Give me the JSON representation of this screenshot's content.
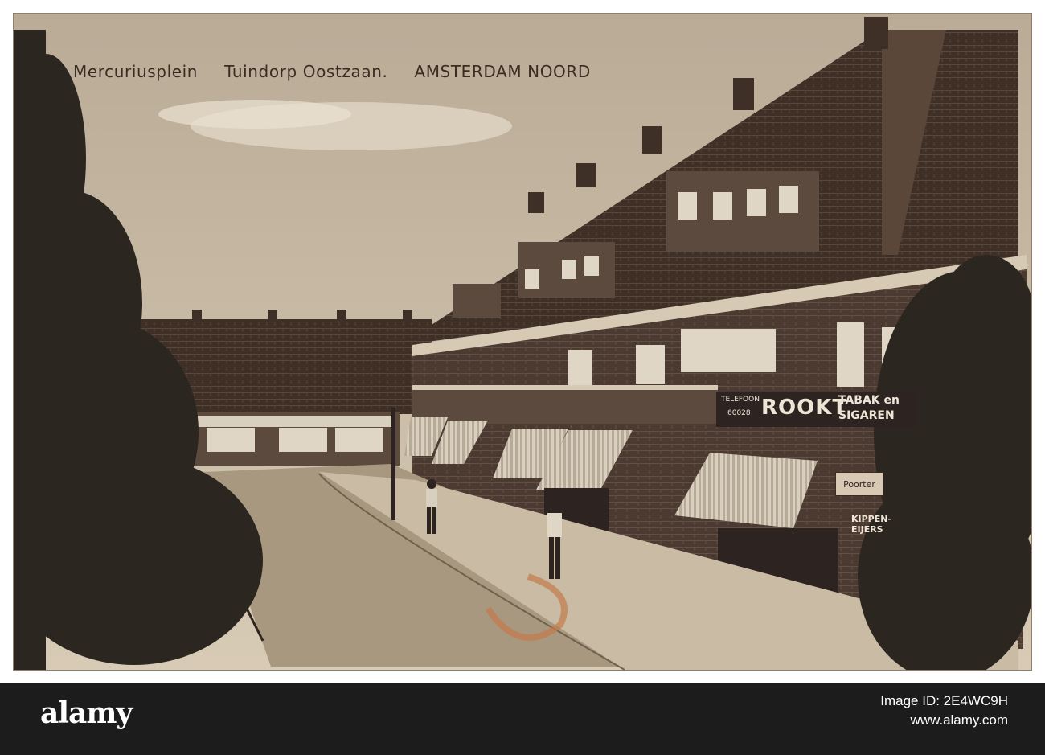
{
  "postcard": {
    "caption": {
      "place": "Mercuriusplein",
      "district": "Tuindorp Oostzaan.",
      "city": "AMSTERDAM NOORD"
    },
    "shop_sign": {
      "phone_label": "TELEFOON",
      "phone_number": "60028",
      "main_word": "ROOKT",
      "line1": "TABAK en",
      "line2": "SIGAREN"
    },
    "small_sign": "Poorter",
    "eggs_sign": "KIPPEN-EIJERS"
  },
  "colors": {
    "sepia_light": "#cdbfa9",
    "sepia_dark": "#2d2320",
    "bar": "#1c1c1c"
  },
  "watermark": {
    "brand": "alamy",
    "image_id": "Image ID: 2E4WC9H",
    "site": "www.alamy.com"
  }
}
